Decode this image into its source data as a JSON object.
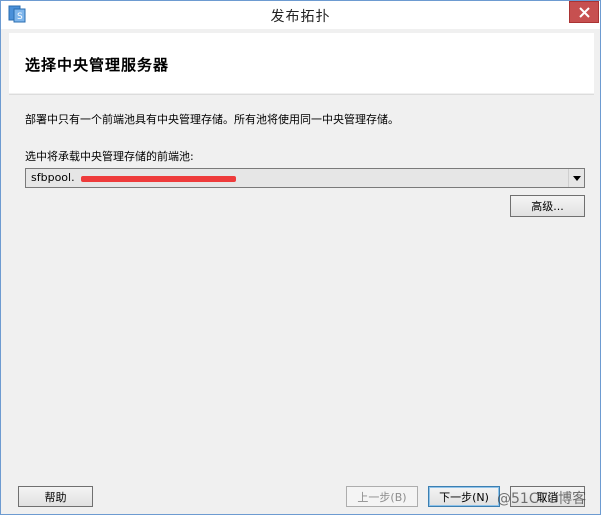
{
  "window": {
    "title": "发布拓扑",
    "accent": "#6d9bd1",
    "close_color": "#c75050",
    "icons": [
      "app-icon",
      "close-icon"
    ]
  },
  "header": {
    "title": "选择中央管理服务器"
  },
  "content": {
    "description": "部署中只有一个前端池具有中央管理存储。所有池将使用同一中央管理存储。",
    "select_label": "选中将承载中央管理存储的前端池:",
    "selected_pool": "sfbpool.",
    "advanced_label": "高级..."
  },
  "footer": {
    "help_label": "帮助",
    "prev_label": "上一步(B)",
    "next_label": "下一步(N)",
    "cancel_label": "取消"
  },
  "watermark": "@51CTO博客"
}
